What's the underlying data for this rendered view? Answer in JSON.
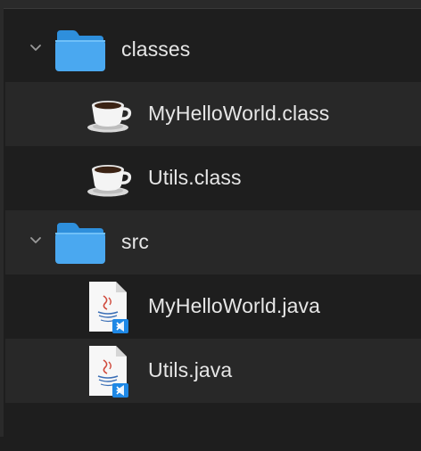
{
  "tree": {
    "items": [
      {
        "type": "folder",
        "label": "classes",
        "expanded": true,
        "icon": "folder-icon"
      },
      {
        "type": "file",
        "label": "MyHelloWorld.class",
        "icon": "coffee-cup-icon"
      },
      {
        "type": "file",
        "label": "Utils.class",
        "icon": "coffee-cup-icon"
      },
      {
        "type": "folder",
        "label": "src",
        "expanded": true,
        "icon": "folder-icon"
      },
      {
        "type": "file",
        "label": "MyHelloWorld.java",
        "icon": "java-file-icon"
      },
      {
        "type": "file",
        "label": "Utils.java",
        "icon": "java-file-icon"
      }
    ]
  },
  "colors": {
    "background": "#1e1e1e",
    "alt_row": "#282828",
    "folder_blue": "#3aa0ef",
    "text": "#e6e6e6",
    "vscode_badge": "#1e88e5"
  }
}
